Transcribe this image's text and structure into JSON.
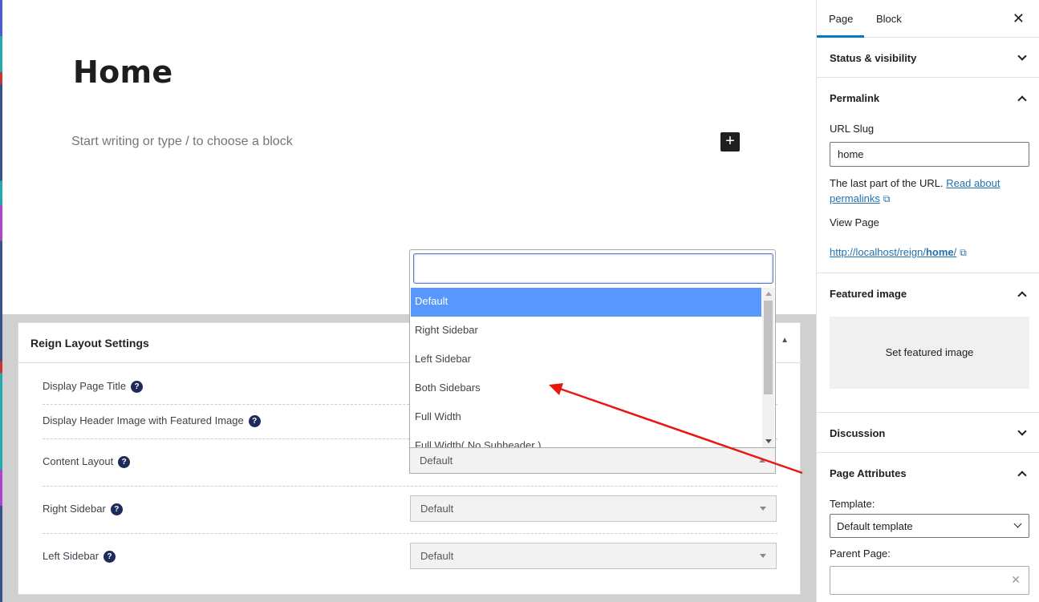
{
  "editor": {
    "title": "Home",
    "placeholder": "Start writing or type / to choose a block",
    "add_block_icon": "+"
  },
  "metabox": {
    "title": "Reign Layout Settings",
    "rows": [
      {
        "label": "Display Page Title"
      },
      {
        "label": "Display Header Image with Featured Image"
      },
      {
        "label": "Content Layout",
        "value": "Default"
      },
      {
        "label": "Right Sidebar",
        "value": "Default"
      },
      {
        "label": "Left Sidebar",
        "value": "Default"
      }
    ],
    "help_glyph": "?"
  },
  "dropdown": {
    "search_value": "",
    "options": [
      "Default",
      "Right Sidebar",
      "Left Sidebar",
      "Both Sidebars",
      "Full Width",
      "Full Width( No Subheader )"
    ],
    "selected_option": "Default"
  },
  "annotation": {
    "color": "#e8170f"
  },
  "sidebar": {
    "tabs": [
      "Page",
      "Block"
    ],
    "close_icon": "✕",
    "status_visibility": "Status & visibility",
    "permalink": {
      "title": "Permalink",
      "url_slug_label": "URL Slug",
      "url_slug_value": "home",
      "help_text": "The last part of the URL.",
      "help_link": "Read about permalinks",
      "view_page_label": "View Page",
      "view_page_url_prefix": "http://localhost/reign/",
      "view_page_url_slug": "home",
      "view_page_url_suffix": "/"
    },
    "featured_image": {
      "title": "Featured image",
      "button": "Set featured image"
    },
    "discussion": "Discussion",
    "page_attributes": {
      "title": "Page Attributes",
      "template_label": "Template:",
      "template_value": "Default template",
      "parent_label": "Parent Page:",
      "clear_icon": "✕"
    }
  },
  "colors": {
    "accent": "#007cba",
    "highlight": "#5897fb",
    "help_bg": "#1e2b5a",
    "link": "#2271b1"
  }
}
